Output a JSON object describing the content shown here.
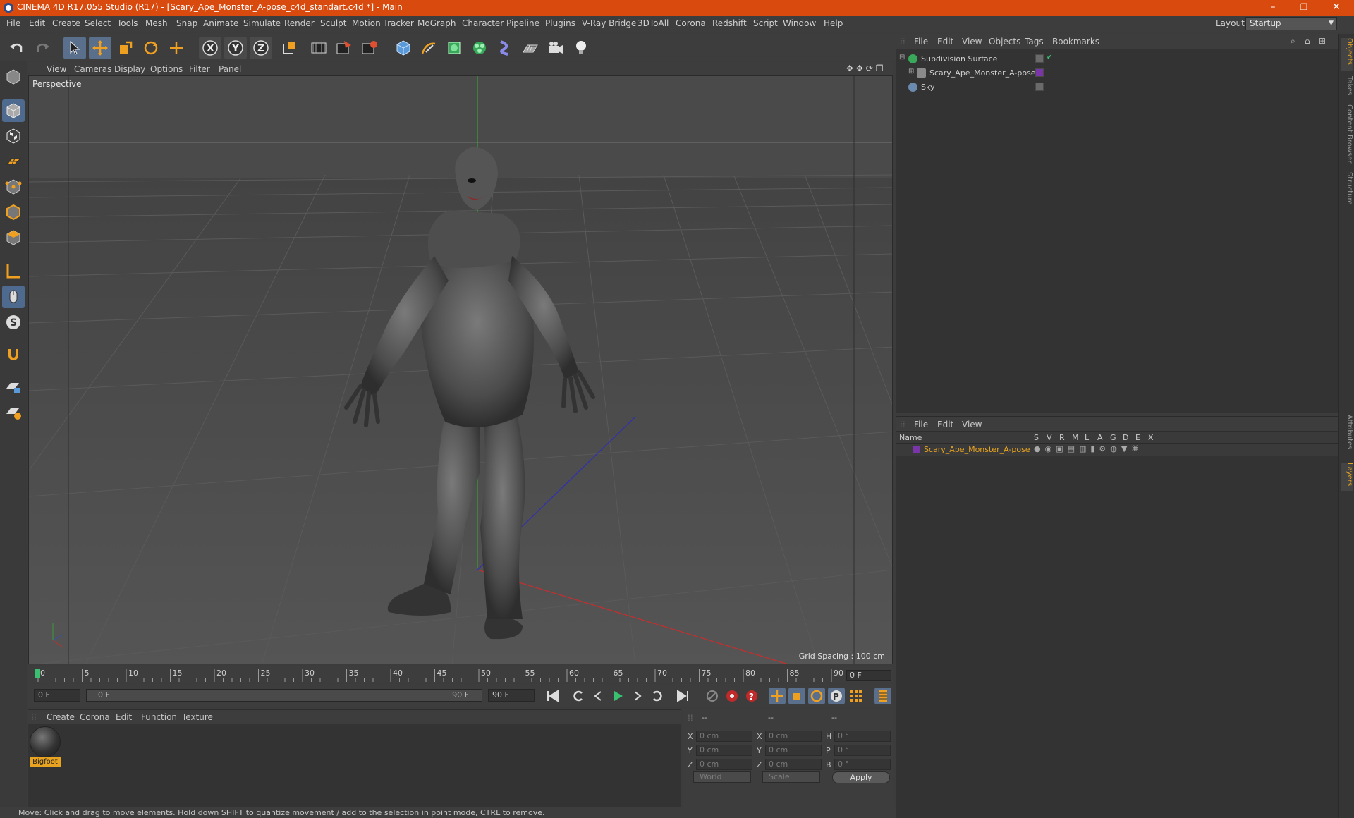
{
  "window": {
    "title": "CINEMA 4D R17.055 Studio (R17) - [Scary_Ape_Monster_A-pose_c4d_standart.c4d *] - Main",
    "minimize": "–",
    "maximize": "❐",
    "close": "✕"
  },
  "menubar": {
    "items": [
      "File",
      "Edit",
      "Create",
      "Select",
      "Tools",
      "Mesh",
      "Snap",
      "Animate",
      "Simulate",
      "Render",
      "Sculpt",
      "Motion Tracker",
      "MoGraph",
      "Character",
      "Pipeline",
      "Plugins",
      "V-Ray Bridge",
      "3DToAll",
      "Corona",
      "Redshift",
      "Script",
      "Window",
      "Help"
    ],
    "layout_label": "Layout:",
    "layout_value": "Startup"
  },
  "viewport": {
    "menu": [
      "View",
      "Cameras",
      "Display",
      "Options",
      "Filter",
      "Panel"
    ],
    "camera_label": "Perspective",
    "grid_spacing": "Grid Spacing : 100 cm"
  },
  "timeline": {
    "ticks": [
      "0",
      "5",
      "10",
      "15",
      "20",
      "25",
      "30",
      "35",
      "40",
      "45",
      "50",
      "55",
      "60",
      "65",
      "70",
      "75",
      "80",
      "85",
      "90"
    ],
    "current_frame": "0 F",
    "start_field": "0 F",
    "range_start": "0 F",
    "range_end": "90 F",
    "end_field": "90 F"
  },
  "material_manager": {
    "menu": [
      "Create",
      "Corona",
      "Edit",
      "Function",
      "Texture"
    ],
    "materials": [
      {
        "name": "Bigfoot"
      }
    ]
  },
  "coordinates": {
    "headers": [
      "--",
      "--",
      "--"
    ],
    "rows": [
      {
        "a": "X",
        "av": "0 cm",
        "b": "X",
        "bv": "0 cm",
        "c": "H",
        "cv": "0 °"
      },
      {
        "a": "Y",
        "av": "0 cm",
        "b": "Y",
        "bv": "0 cm",
        "c": "P",
        "cv": "0 °"
      },
      {
        "a": "Z",
        "av": "0 cm",
        "b": "Z",
        "bv": "0 cm",
        "c": "B",
        "cv": "0 °"
      }
    ],
    "space_dropdown": "World",
    "mode_dropdown": "Scale",
    "apply_label": "Apply"
  },
  "status": {
    "text": "Move: Click and drag to move elements. Hold down SHIFT to quantize movement / add to the selection in point mode, CTRL to remove."
  },
  "object_manager": {
    "menu": [
      "File",
      "Edit",
      "View",
      "Objects",
      "Tags",
      "Bookmarks"
    ],
    "objects": [
      {
        "name": "Subdivision Surface",
        "color": "#3aa85a"
      },
      {
        "name": "Scary_Ape_Monster_A-pose",
        "color": "#8a8a8a"
      },
      {
        "name": "Sky",
        "color": "#6a8ab0"
      }
    ]
  },
  "layer_manager": {
    "menu": [
      "File",
      "Edit",
      "View"
    ],
    "columns": [
      "Name",
      "S",
      "V",
      "R",
      "M",
      "L",
      "A",
      "G",
      "D",
      "E",
      "X"
    ],
    "layers": [
      {
        "name": "Scary_Ape_Monster_A-pose",
        "color": "#7a35a8"
      }
    ]
  },
  "side_tabs": [
    "Objects",
    "Takes",
    "Content Browser",
    "Structure",
    "Attributes",
    "Layers"
  ],
  "colors": {
    "accent_orange": "#e8a320",
    "title_bar": "#d84a0e",
    "active_tool": "#5a6f8c"
  }
}
